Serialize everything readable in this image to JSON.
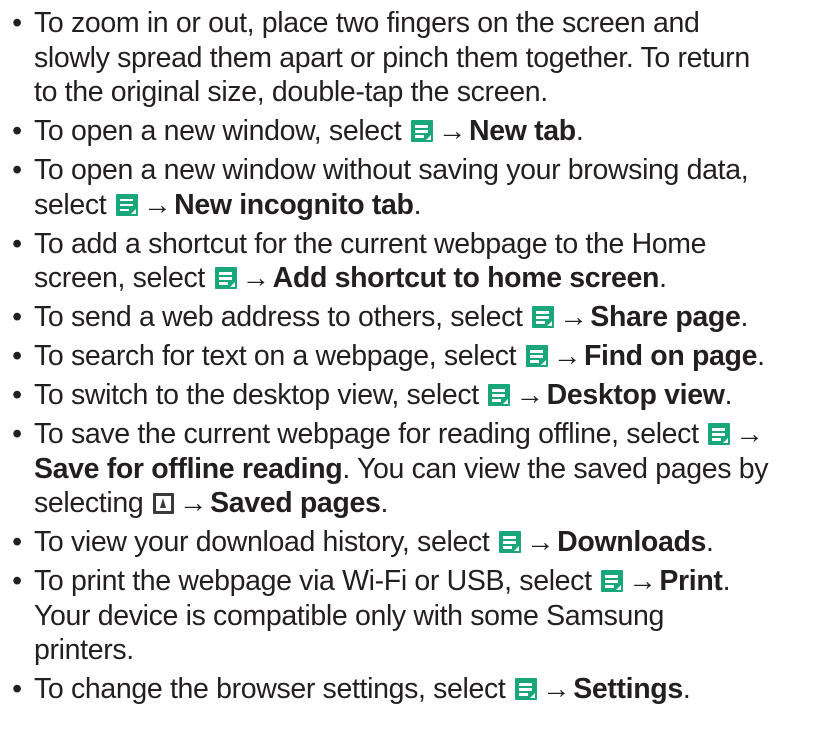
{
  "colors": {
    "text": "#231f20",
    "menu_icon": "#19a77a",
    "bookmark_icon": "#3a3a3a"
  },
  "icons": {
    "menu": "menu-icon",
    "bookmark": "bookmark-icon",
    "arrow": "→",
    "bullet": "•"
  },
  "items": [
    {
      "line1": "To zoom in or out, place two fingers on the screen and",
      "line2": "slowly spread them apart or pinch them together. To return",
      "line3": "to the original size, double-tap the screen."
    },
    {
      "text": "To open a new window, select",
      "target": "New tab",
      "end": "."
    },
    {
      "line1": "To open a new window without saving your browsing data,",
      "text2": "select",
      "target": "New incognito tab",
      "end": "."
    },
    {
      "line1": "To add a shortcut for the current webpage to the Home",
      "text2": "screen, select",
      "target": "Add shortcut to home screen",
      "end": "."
    },
    {
      "text": "To send a web address to others, select",
      "target": "Share page",
      "end": "."
    },
    {
      "text": "To search for text on a webpage, select",
      "target": "Find on page",
      "end": "."
    },
    {
      "text": "To switch to the desktop view, select",
      "target": "Desktop view",
      "end": "."
    },
    {
      "text": "To save the current webpage for reading offline, select",
      "target": "Save for offline reading",
      "mid": ". You can view the saved pages by",
      "text3": "selecting",
      "target2": "Saved pages",
      "end": "."
    },
    {
      "text": "To view your download history, select",
      "target": "Downloads",
      "end": "."
    },
    {
      "text": "To print the webpage via Wi-Fi or USB, select",
      "target": "Print",
      "end": ".",
      "line2": "Your device is compatible only with some Samsung",
      "line3": "printers."
    },
    {
      "text": "To change the browser settings, select",
      "target": "Settings",
      "end": "."
    }
  ]
}
